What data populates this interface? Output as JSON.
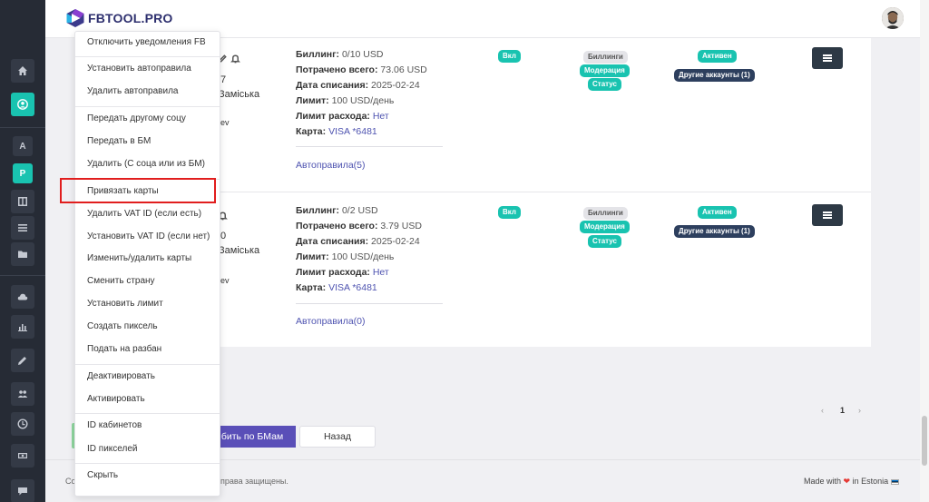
{
  "app": {
    "logo_text": "FBTOOL.PRO",
    "brand_color": "#2d2f6e",
    "accent_color": "#19c3b0"
  },
  "sidebar": {
    "icons": [
      "home-icon",
      "user-circle-icon",
      "table-icon",
      "list-icon",
      "folder-icon",
      "cloud-upload-icon",
      "bar-chart-icon",
      "edit-icon",
      "users-icon",
      "clock-icon",
      "money-icon",
      "chat-icon"
    ],
    "letters": [
      "A",
      "P"
    ]
  },
  "row_fragments": [
    {
      "line1": "7",
      "line2": "Заміська",
      "line3": "ev"
    },
    {
      "line1": "0",
      "line2": "Заміська",
      "line3": "ev"
    }
  ],
  "accounts": [
    {
      "billing_label": "Биллинг:",
      "billing_value": "0/10 USD",
      "spent_label": "Потрачено всего:",
      "spent_value": "73.06 USD",
      "charge_date_label": "Дата списания:",
      "charge_date_value": "2025-02-24",
      "limit_label": "Лимит:",
      "limit_value": "100 USD/день",
      "spend_limit_label": "Лимит расхода:",
      "spend_limit_value": "Нет",
      "card_label": "Карта:",
      "card_value": "VISA *6481",
      "autorules": "Автоправила(5)",
      "status_on": "Вкл",
      "tags": [
        "Биллинги",
        "Модерация",
        "Статус"
      ],
      "active": "Активен",
      "other_accounts": "Другие аккаунты (1)"
    },
    {
      "billing_label": "Биллинг:",
      "billing_value": "0/2 USD",
      "spent_label": "Потрачено всего:",
      "spent_value": "3.79 USD",
      "charge_date_label": "Дата списания:",
      "charge_date_value": "2025-02-24",
      "limit_label": "Лимит:",
      "limit_value": "100 USD/день",
      "spend_limit_label": "Лимит расхода:",
      "spend_limit_value": "Нет",
      "card_label": "Карта:",
      "card_value": "VISA *6481",
      "autorules": "Автоправила(0)",
      "status_on": "Вкл",
      "tags": [
        "Биллинги",
        "Модерация",
        "Статус"
      ],
      "active": "Активен",
      "other_accounts": "Другие аккаунты (1)"
    }
  ],
  "pagination": {
    "prev": "‹",
    "current": "1",
    "next": "›"
  },
  "actions": {
    "primary_label": "бить по БМам",
    "back_label": "Назад"
  },
  "dropdown": {
    "items": [
      "Отключить уведомления FB",
      "Установить автоправила",
      "Удалить автоправила",
      "Передать другому соцу",
      "Передать в БМ",
      "Удалить (С соца или из БМ)",
      "Привязать карты",
      "Удалить VAT ID (если есть)",
      "Установить VAT ID (если нет)",
      "Изменить/удалить карты",
      "Сменить страну",
      "Установить лимит",
      "Создать пиксель",
      "Подать на разбан",
      "Деактивировать",
      "Активировать",
      "ID кабинетов",
      "ID пикселей",
      "Скрыть"
    ],
    "highlighted": "Привязать карты"
  },
  "footer": {
    "left_prefix": "Co",
    "left_text": "се права защищены.",
    "right_prefix": "Made with",
    "right_suffix": "in Estonia"
  }
}
